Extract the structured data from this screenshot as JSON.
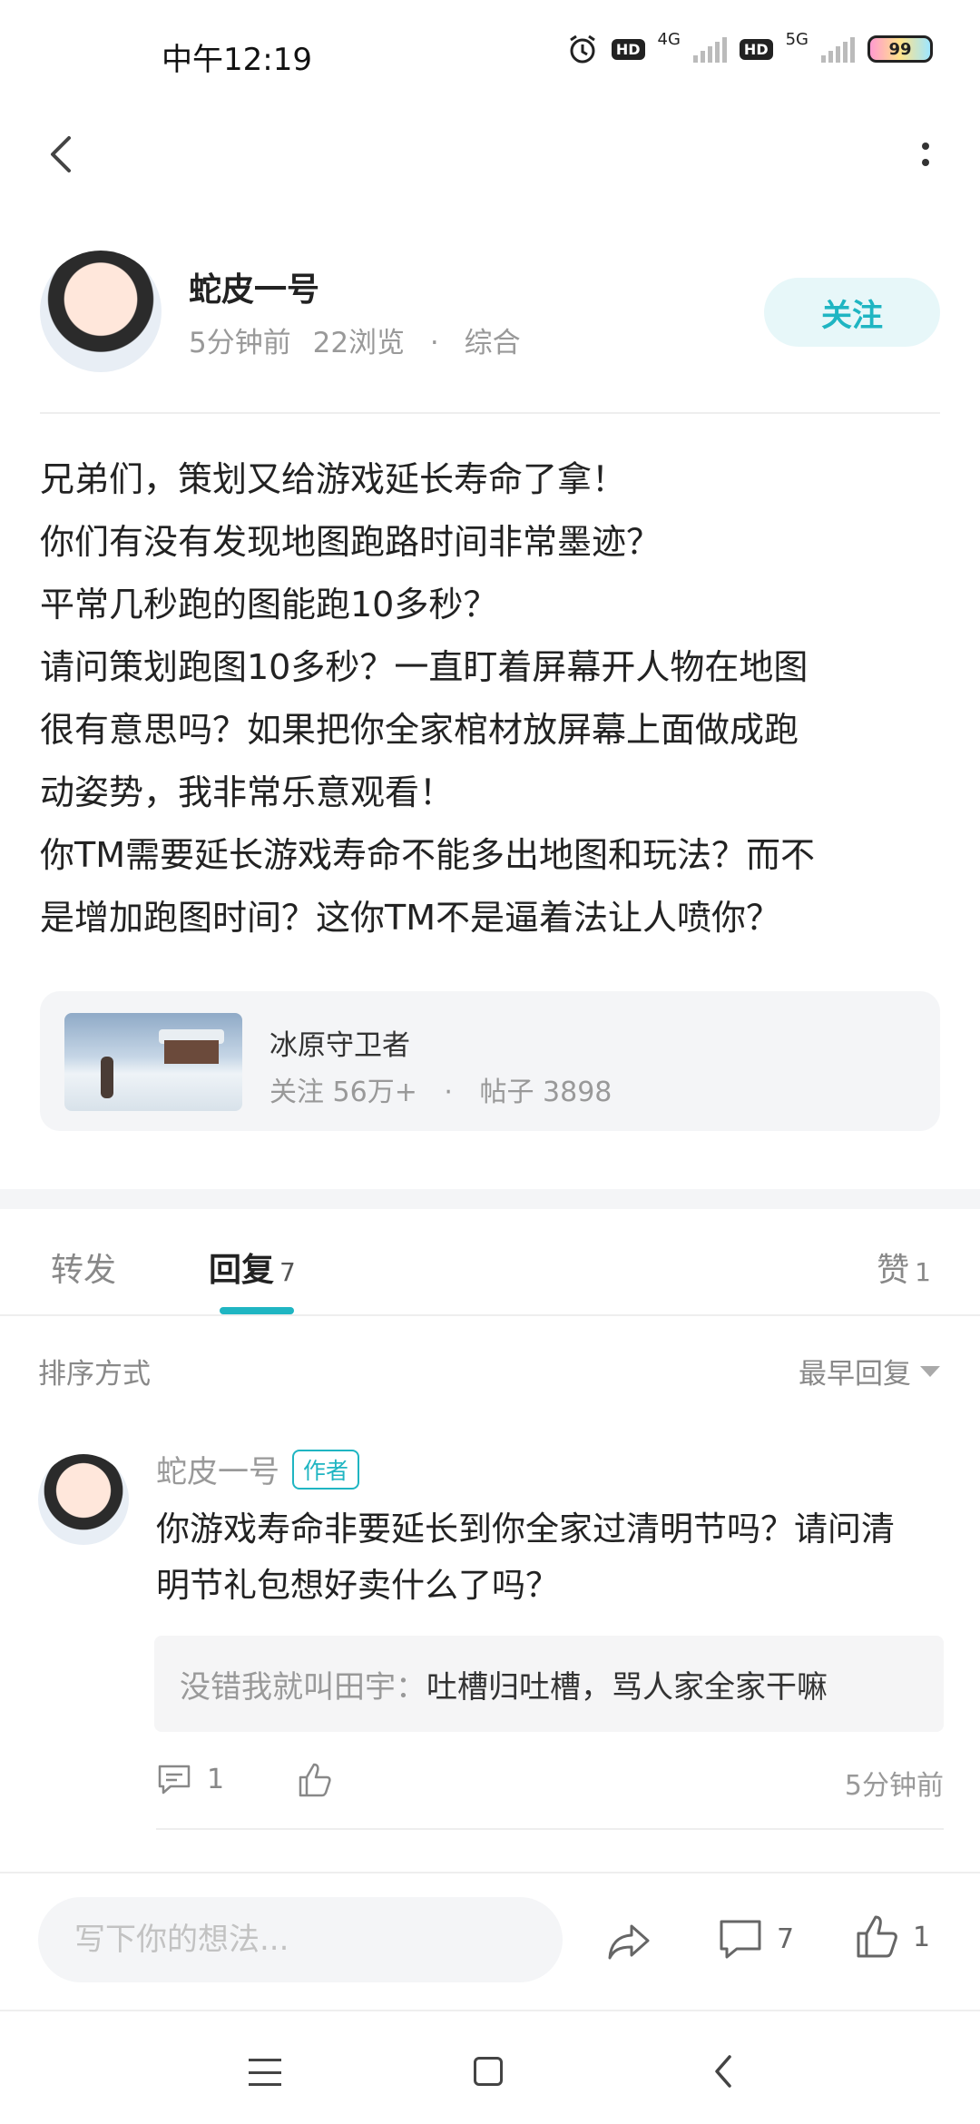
{
  "status_bar": {
    "time": "中午12:19",
    "network1": "4G",
    "network2": "5G",
    "hd": "HD",
    "battery": "99"
  },
  "post": {
    "author": {
      "name": "蛇皮一号",
      "time": "5分钟前",
      "views": "22浏览",
      "separator": "·",
      "category": "综合"
    },
    "follow_label": "关注",
    "body_lines": [
      "兄弟们，策划又给游戏延长寿命了拿！",
      "你们有没有发现地图跑路时间非常墨迹？",
      "平常几秒跑的图能跑10多秒？",
      "请问策划跑图10多秒？一直盯着屏幕开人物在地图",
      "很有意思吗？如果把你全家棺材放屏幕上面做成跑",
      "动姿势，我非常乐意观看！",
      "你TM需要延长游戏寿命不能多出地图和玩法？而不",
      "是增加跑图时间？这你TM不是逼着法让人喷你？"
    ],
    "game_card": {
      "name": "冰原守卫者",
      "followers": "关注 56万+",
      "separator": "·",
      "posts": "帖子 3898"
    }
  },
  "tabs": {
    "forward": "转发",
    "reply": "回复",
    "reply_count": "7",
    "like": "赞",
    "like_count": "1"
  },
  "sort": {
    "label": "排序方式",
    "selected": "最早回复"
  },
  "comment": {
    "name": "蛇皮一号",
    "badge": "作者",
    "text_lines": [
      "你游戏寿命非要延长到你全家过清明节吗？请问清",
      "明节礼包想好卖什么了吗？"
    ],
    "sub_reply_user": "没错我就叫田宇：",
    "sub_reply_text": "吐槽归吐槽，骂人家全家干嘛",
    "reply_count": "1",
    "time": "5分钟前"
  },
  "bottom_bar": {
    "placeholder": "写下你的想法...",
    "comment_count": "7",
    "like_count": "1"
  },
  "colors": {
    "accent": "#1fb5c2",
    "follow_bg": "#e7f7f9",
    "muted_text": "#999999",
    "card_bg": "#f4f5f7"
  }
}
